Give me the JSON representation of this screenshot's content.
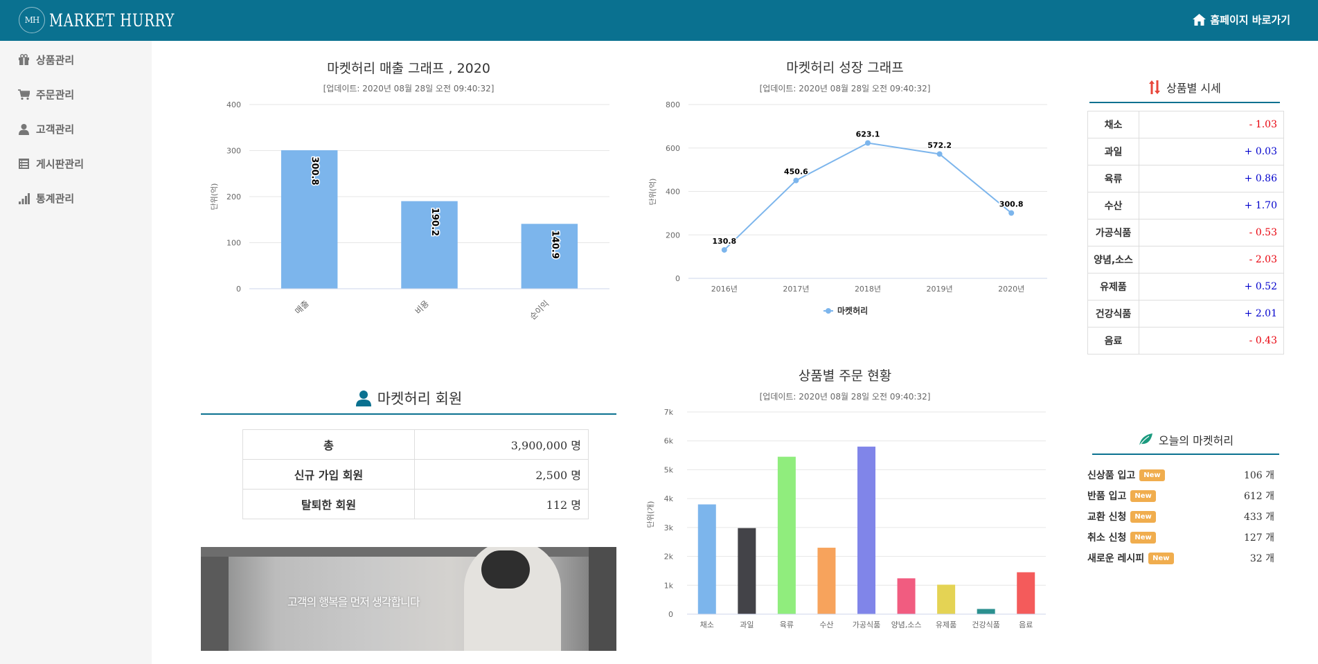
{
  "header": {
    "logo_mark": "MH",
    "logo_text": "MARKET HURRY",
    "home_link": "홈페이지 바로가기"
  },
  "sidebar": {
    "items": [
      {
        "label": "상품관리",
        "icon": "gift-icon"
      },
      {
        "label": "주문관리",
        "icon": "cart-icon"
      },
      {
        "label": "고객관리",
        "icon": "user-icon"
      },
      {
        "label": "게시판관리",
        "icon": "list-icon"
      },
      {
        "label": "통계관리",
        "icon": "signal-icon"
      }
    ]
  },
  "sales_chart": {
    "title": "마켓허리 매출 그래프 , 2020",
    "subtitle": "[업데이트: 2020년 08월 28일 오전 09:40:32]"
  },
  "growth_chart": {
    "title": "마켓허리 성장 그래프",
    "subtitle": "[업데이트: 2020년 08월 28일 오전 09:40:32]"
  },
  "order_chart": {
    "title": "상품별 주문 현황",
    "subtitle": "[업데이트: 2020년 08월 28일 오전 09:40:32]"
  },
  "chart_data": [
    {
      "type": "bar",
      "title": "마켓허리 매출 그래프 , 2020",
      "ylabel": "단위(억)",
      "ylim": [
        0,
        400
      ],
      "yticks": [
        0,
        100,
        200,
        300,
        400
      ],
      "categories": [
        "매출",
        "비용",
        "순이익"
      ],
      "values": [
        300.8,
        190.2,
        140.9
      ],
      "data_labels": [
        "300.8",
        "190.2",
        "140.9"
      ],
      "color": "#7cb5ec"
    },
    {
      "type": "line",
      "title": "마켓허리 성장 그래프",
      "ylabel": "단위(억)",
      "ylim": [
        0,
        800
      ],
      "yticks": [
        0,
        200,
        400,
        600,
        800
      ],
      "x": [
        "2016년",
        "2017년",
        "2018년",
        "2019년",
        "2020년"
      ],
      "series": [
        {
          "name": "마켓허리",
          "values": [
            130.8,
            450.6,
            623.1,
            572.2,
            300.8
          ]
        }
      ],
      "data_labels": [
        "130.8",
        "450.6",
        "623.1",
        "572.2",
        "300.8"
      ],
      "legend": "bottom-center",
      "color": "#7cb5ec"
    },
    {
      "type": "bar",
      "title": "상품별 주문 현황",
      "ylabel": "단위(개)",
      "ylim": [
        0,
        7000
      ],
      "yticks": [
        0,
        1000,
        2000,
        3000,
        4000,
        5000,
        6000,
        7000
      ],
      "ytick_labels": [
        "0",
        "1k",
        "2k",
        "3k",
        "4k",
        "5k",
        "6k",
        "7k"
      ],
      "categories": [
        "채소",
        "과일",
        "육류",
        "수산",
        "가공식품",
        "양념,소스",
        "유제품",
        "건강식품",
        "음료"
      ],
      "values": [
        3800,
        2980,
        5450,
        2300,
        5800,
        1240,
        1020,
        180,
        1450
      ],
      "colors": [
        "#7cb5ec",
        "#434348",
        "#90ed7d",
        "#f7a35c",
        "#8085e9",
        "#f15c80",
        "#e4d354",
        "#2b908f",
        "#f45b5b"
      ]
    }
  ],
  "members": {
    "title": "마켓허리 회원",
    "rows": [
      {
        "label": "총",
        "value": "3,900,000 명"
      },
      {
        "label": "신규 가입 회원",
        "value": "2,500 명"
      },
      {
        "label": "탈퇴한 회원",
        "value": "112 명"
      }
    ]
  },
  "banner": {
    "text": "고객의 행복을 먼저 생각합니다"
  },
  "price": {
    "title": "상품별 시세",
    "rows": [
      {
        "label": "채소",
        "value": "- 1.03",
        "color": "#e8000b"
      },
      {
        "label": "과일",
        "value": "+ 0.03",
        "color": "#0000cc"
      },
      {
        "label": "육류",
        "value": "+ 0.86",
        "color": "#0000cc"
      },
      {
        "label": "수산",
        "value": "+ 1.70",
        "color": "#0000cc"
      },
      {
        "label": "가공식품",
        "value": "- 0.53",
        "color": "#e8000b"
      },
      {
        "label": "양념,소스",
        "value": "- 2.03",
        "color": "#e8000b"
      },
      {
        "label": "유제품",
        "value": "+ 0.52",
        "color": "#0000cc"
      },
      {
        "label": "건강식품",
        "value": "+ 2.01",
        "color": "#0000cc"
      },
      {
        "label": "음료",
        "value": "- 0.43",
        "color": "#e8000b"
      }
    ]
  },
  "today": {
    "title": "오늘의 마켓허리",
    "badge": "New",
    "rows": [
      {
        "label": "신상품 입고",
        "count": "106 개"
      },
      {
        "label": "반품 입고",
        "count": "612 개"
      },
      {
        "label": "교환 신청",
        "count": "433 개"
      },
      {
        "label": "취소 신청",
        "count": "127 개"
      },
      {
        "label": "새로운 레시피",
        "count": "32 개"
      }
    ]
  },
  "colors": {
    "header": "#0a7190",
    "accent_red": "#e8000b",
    "accent_blue": "#0000cc",
    "badge": "#f0ad4e"
  }
}
